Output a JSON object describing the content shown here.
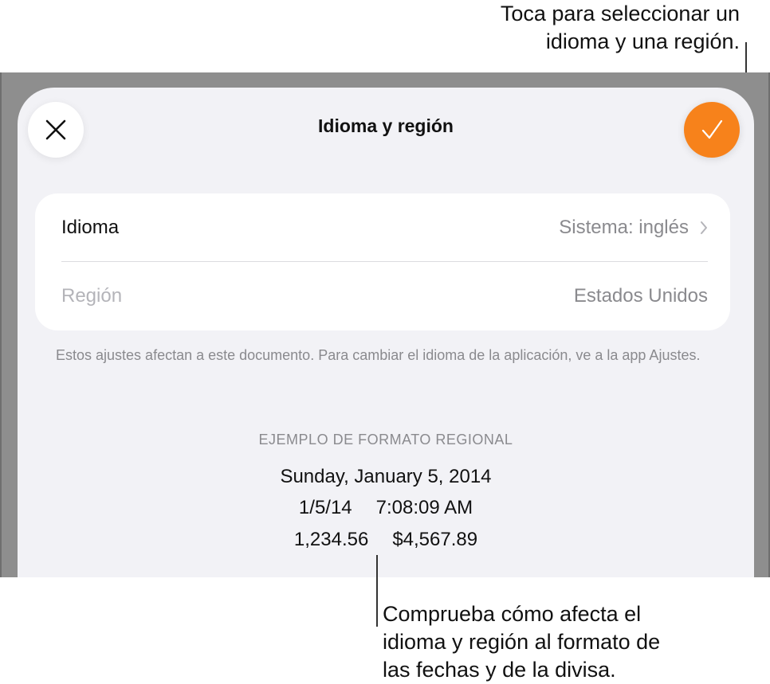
{
  "callouts": {
    "top": [
      "Toca para seleccionar un",
      "idioma y una región."
    ],
    "bottom": [
      "Comprueba cómo afecta el",
      "idioma y región al formato de",
      "las fechas y de la divisa."
    ]
  },
  "sheet": {
    "title": "Idioma y región",
    "close_icon": "close-icon",
    "done_icon": "checkmark-icon",
    "accent_color": "#f7821b"
  },
  "settings": {
    "language": {
      "label": "Idioma",
      "value": "Sistema: inglés"
    },
    "region": {
      "label": "Región",
      "value": "Estados Unidos"
    }
  },
  "footnote": "Estos ajustes afectan a este documento. Para cambiar el idioma de la aplicación, ve a la app Ajustes.",
  "sample": {
    "header": "EJEMPLO DE FORMATO REGIONAL",
    "date_long": "Sunday, January 5, 2014",
    "date_short": "1/5/14",
    "time": "7:08:09 AM",
    "number": "1,234.56",
    "currency": "$4,567.89"
  }
}
